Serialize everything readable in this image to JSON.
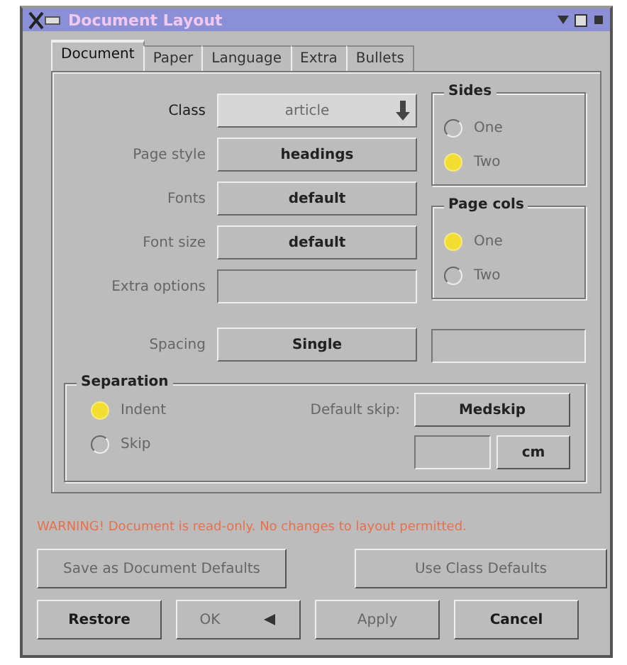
{
  "window": {
    "title": "Document Layout"
  },
  "tabs": [
    {
      "label": "Document",
      "selected": true
    },
    {
      "label": "Paper",
      "selected": false
    },
    {
      "label": "Language",
      "selected": false
    },
    {
      "label": "Extra",
      "selected": false
    },
    {
      "label": "Bullets",
      "selected": false
    }
  ],
  "fields": [
    {
      "label": "Class",
      "value": "article",
      "kind": "dropdown",
      "disabled": false
    },
    {
      "label": "Page style",
      "value": "headings",
      "kind": "button",
      "disabled": true
    },
    {
      "label": "Fonts",
      "value": "default",
      "kind": "button",
      "disabled": true
    },
    {
      "label": "Font size",
      "value": "default",
      "kind": "button",
      "disabled": true
    },
    {
      "label": "Extra options",
      "kind": "text",
      "disabled": true
    },
    {
      "label": "Spacing",
      "value": "Single",
      "kind": "button",
      "disabled": true
    }
  ],
  "sides": {
    "title": "Sides",
    "options": [
      {
        "label": "One",
        "selected": false,
        "disabled": true
      },
      {
        "label": "Two",
        "selected": true,
        "disabled": true
      }
    ]
  },
  "page_cols": {
    "title": "Page cols",
    "options": [
      {
        "label": "One",
        "selected": true,
        "disabled": true
      },
      {
        "label": "Two",
        "selected": false,
        "disabled": true
      }
    ]
  },
  "separation": {
    "title": "Separation",
    "options": [
      {
        "label": "Indent",
        "selected": true,
        "disabled": true
      },
      {
        "label": "Skip",
        "selected": false,
        "disabled": true
      }
    ],
    "default_skip": {
      "label": "Default skip:",
      "value": "Medskip",
      "unit": "cm",
      "disabled": true
    }
  },
  "warning": "WARNING! Document is read-only. No changes to layout permitted.",
  "buttons": [
    {
      "label": "Save as Document Defaults",
      "disabled": true
    },
    {
      "label": "Use Class Defaults",
      "disabled": true
    },
    {
      "label": "Restore",
      "disabled": false
    },
    {
      "label": "OK",
      "disabled": true
    },
    {
      "label": "Apply",
      "disabled": true
    },
    {
      "label": "Cancel",
      "disabled": false
    }
  ]
}
